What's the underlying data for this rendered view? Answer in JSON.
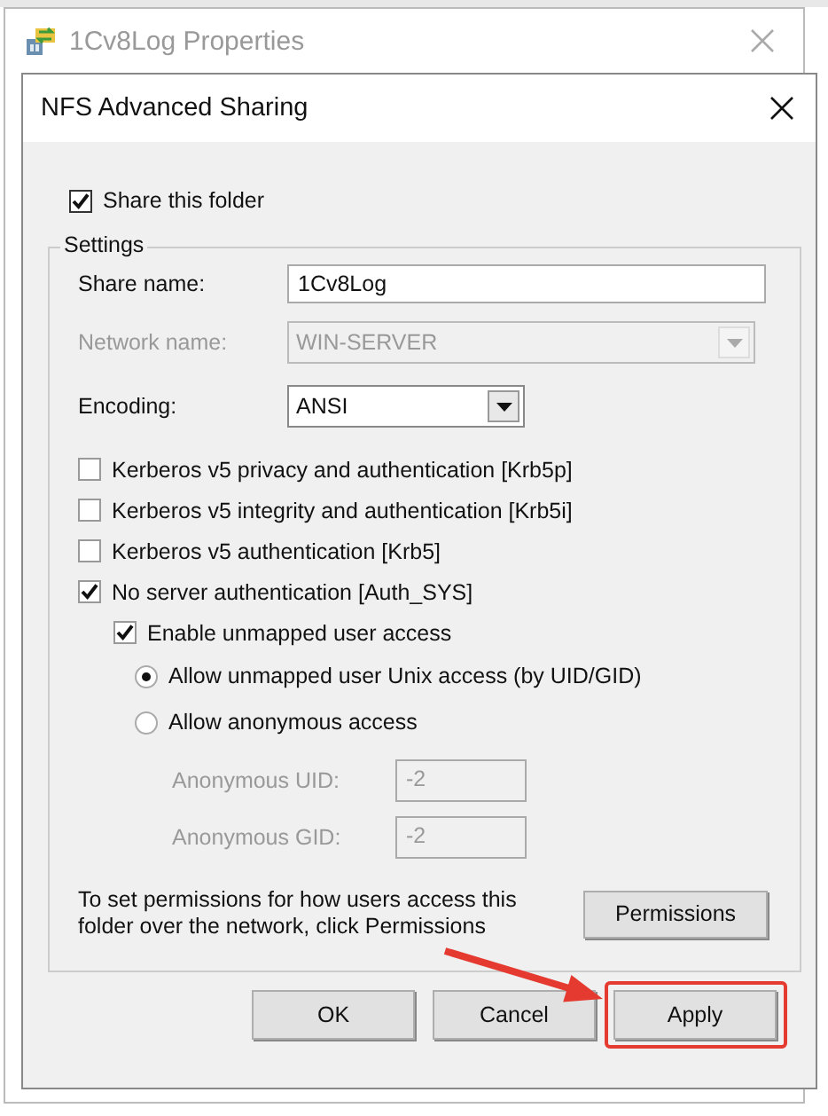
{
  "outer_window": {
    "title": "1Cv8Log Properties"
  },
  "dialog": {
    "title": "NFS Advanced Sharing"
  },
  "share_folder": {
    "label": "Share this folder",
    "checked": true
  },
  "settings": {
    "legend": "Settings",
    "fields": [
      {
        "kind": "text",
        "label": "Share name:",
        "value": "1Cv8Log",
        "disabled": false
      },
      {
        "kind": "dropdown",
        "label": "Network name:",
        "value": "WIN-SERVER",
        "disabled": true
      },
      {
        "kind": "dropdown",
        "label": "Encoding:",
        "value": "ANSI",
        "disabled": false
      }
    ],
    "auth_options": [
      {
        "label": "Kerberos v5 privacy and authentication [Krb5p]",
        "checked": false
      },
      {
        "label": "Kerberos v5 integrity and authentication [Krb5i]",
        "checked": false
      },
      {
        "label": "Kerberos v5 authentication [Krb5]",
        "checked": false
      },
      {
        "label": "No server authentication [Auth_SYS]",
        "checked": true
      }
    ],
    "unmapped": {
      "label": "Enable unmapped user access",
      "checked": true
    },
    "access_options": [
      {
        "label": "Allow unmapped user Unix access (by UID/GID)",
        "selected": true
      },
      {
        "label": "Allow anonymous access",
        "selected": false
      }
    ],
    "anonymous_fields": [
      {
        "label": "Anonymous UID:",
        "value": "-2",
        "disabled": true
      },
      {
        "label": "Anonymous GID:",
        "value": "-2",
        "disabled": true
      }
    ],
    "permissions_note": "To set permissions for how users access this folder over the network, click Permissions",
    "permissions_button": "Permissions"
  },
  "buttons": [
    {
      "label": "OK",
      "highlighted": false
    },
    {
      "label": "Cancel",
      "highlighted": false
    },
    {
      "label": "Apply",
      "highlighted": true
    }
  ]
}
